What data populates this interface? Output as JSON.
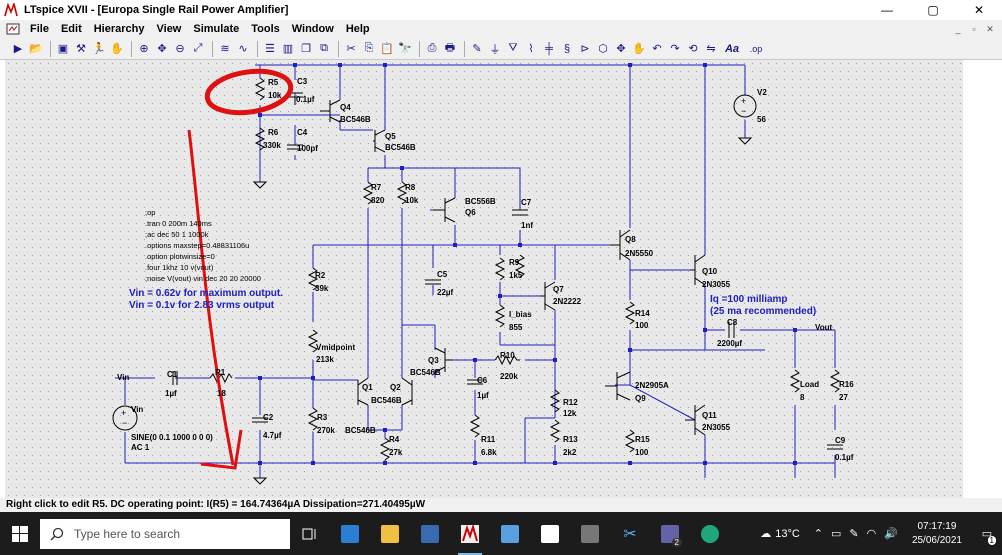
{
  "window": {
    "title": "LTspice XVII - [Europa Single Rail Power Amplifier]",
    "min": "—",
    "max": "▢",
    "close": "✕"
  },
  "menu": [
    {
      "label": "File"
    },
    {
      "label": "Edit"
    },
    {
      "label": "Hierarchy"
    },
    {
      "label": "View"
    },
    {
      "label": "Simulate"
    },
    {
      "label": "Tools"
    },
    {
      "label": "Window"
    },
    {
      "label": "Help"
    }
  ],
  "toolbar": {
    "font_label": "Aa",
    "op_label": ".op"
  },
  "schematic": {
    "spice_directives": [
      ";op",
      ".tran 0 200m 140ms",
      ";ac dec 50 1 1000k",
      ".options maxstep=0.48831106u",
      ".option plotwinsize=0",
      ".four 1khz 10 v(vout)",
      ";noise V(vout) vin dec 20 20 20000"
    ],
    "notes": {
      "vin_max": "Vin = 0.62v for maximum output.",
      "vin_283": "Vin = 0.1v for 2.83 vrms output",
      "iq": "Iq =100 milliamp",
      "iq_rec": "(25 ma recommended)"
    },
    "components": {
      "R5": {
        "name": "R5",
        "value": "10k"
      },
      "C3": {
        "name": "C3",
        "value": "0.1µf"
      },
      "Q4": {
        "name": "Q4",
        "value": "BC546B"
      },
      "R6": {
        "name": "R6",
        "value": "330k"
      },
      "C4": {
        "name": "C4",
        "value": "100pf"
      },
      "Q5": {
        "name": "Q5",
        "value": "BC546B"
      },
      "R7": {
        "name": "R7",
        "value": "820"
      },
      "R8": {
        "name": "R8",
        "value": "10k"
      },
      "Q6": {
        "name": "Q6",
        "value": "BC556B"
      },
      "C7": {
        "name": "C7",
        "value": "1nf"
      },
      "Q8": {
        "name": "Q8",
        "value": "2N5550"
      },
      "R9": {
        "name": "R9",
        "value": "1k5"
      },
      "Q7": {
        "name": "Q7",
        "value": "2N2222"
      },
      "Ibias": {
        "name": "I_bias",
        "value": "855"
      },
      "R2": {
        "name": "R2",
        "value": "39k"
      },
      "C5": {
        "name": "C5",
        "value": "22µf"
      },
      "Vmid": {
        "name": "Vmidpoint",
        "value": "213k"
      },
      "Q3": {
        "name": "Q3",
        "value": "BC546B"
      },
      "R10": {
        "name": "R10",
        "value": "220k"
      },
      "C6": {
        "name": "C6",
        "value": "1µf"
      },
      "Q1": {
        "name": "Q1",
        "value": "BC546B"
      },
      "Q2": {
        "name": "Q2",
        "value": ""
      },
      "R1": {
        "name": "R1",
        "value": "18"
      },
      "C1": {
        "name": "C1",
        "value": "1µf"
      },
      "C2": {
        "name": "C2",
        "value": "4.7µf"
      },
      "R3": {
        "name": "R3",
        "value": "270k"
      },
      "Q1b": {
        "name": "",
        "value": "BC546B"
      },
      "R4": {
        "name": "R4",
        "value": "27k"
      },
      "R11": {
        "name": "R11",
        "value": "6.8k"
      },
      "R12": {
        "name": "R12",
        "value": "12k"
      },
      "R13": {
        "name": "R13",
        "value": "2k2"
      },
      "Q9": {
        "name": "Q9",
        "value": "2N2905A"
      },
      "R14": {
        "name": "R14",
        "value": "100"
      },
      "R15": {
        "name": "R15",
        "value": "100"
      },
      "Q10": {
        "name": "Q10",
        "value": "2N3055"
      },
      "Q11": {
        "name": "Q11",
        "value": "2N3055"
      },
      "C8": {
        "name": "C8",
        "value": "2200µf"
      },
      "Load": {
        "name": "Load",
        "value": "8"
      },
      "R16": {
        "name": "R16",
        "value": "27"
      },
      "C9": {
        "name": "C9",
        "value": "0.1µf"
      },
      "V2": {
        "name": "V2",
        "value": "56"
      },
      "Vin": {
        "name": "Vin",
        "value": "SINE(0 0.1 1000 0 0 0)",
        "value2": "AC 1"
      }
    },
    "nets": {
      "vin": "Vin",
      "vout": "Vout"
    }
  },
  "status": "Right click to edit R5.  DC operating point: I(R5) = 164.74364µA  Dissipation=271.40495µW",
  "taskbar": {
    "search_placeholder": "Type here to search",
    "weather": "13°C",
    "time": "07:17:19",
    "date": "25/06/2021",
    "notif_count": "1",
    "badge": "2"
  }
}
